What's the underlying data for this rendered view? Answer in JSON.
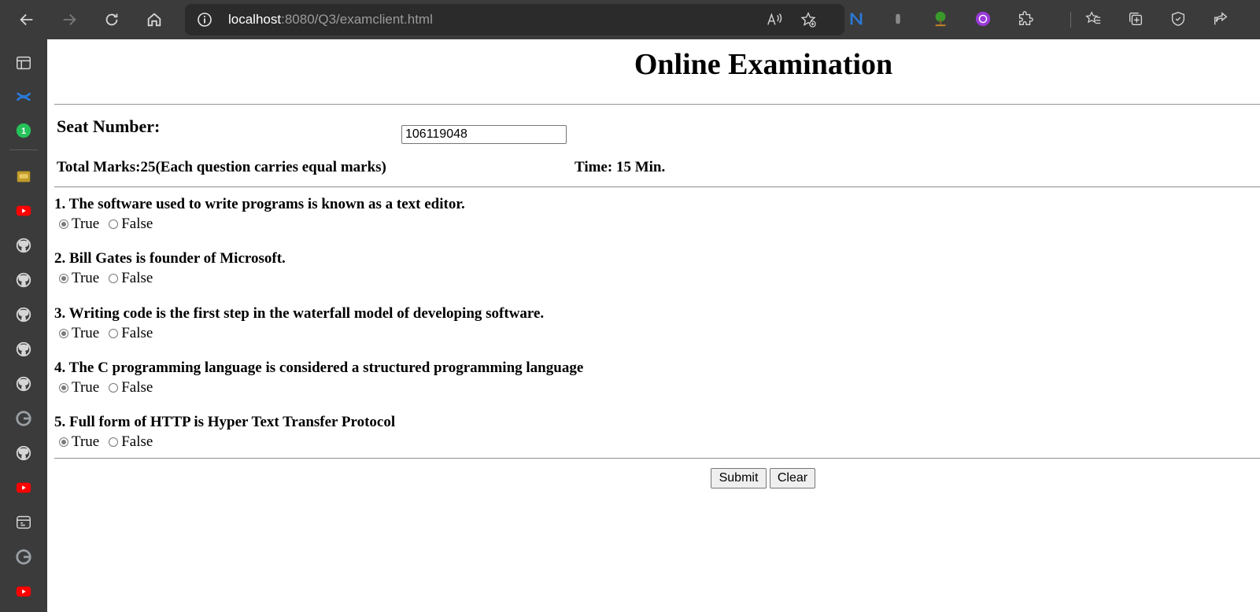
{
  "browser": {
    "url_host": "localhost",
    "url_path": ":8080/Q3/examclient.html"
  },
  "page": {
    "title": "Online Examination",
    "seat_label": "Seat Number:",
    "seat_value": "106119048",
    "total_marks": "Total Marks:25(Each question carries equal marks)",
    "time": "Time: 15 Min.",
    "questions": [
      {
        "text": "1. The software used to write programs is known as a text editor.",
        "selected": "True"
      },
      {
        "text": "2. Bill Gates is founder of Microsoft.",
        "selected": "True"
      },
      {
        "text": "3. Writing code is the first step in the waterfall model of developing software.",
        "selected": "True"
      },
      {
        "text": "4. The C programming language is considered a structured programming language",
        "selected": "True"
      },
      {
        "text": "5. Full form of HTTP is Hyper Text Transfer Protocol",
        "selected": "True"
      }
    ],
    "option_true": "True",
    "option_false": "False",
    "submit_label": "Submit",
    "clear_label": "Clear"
  },
  "colors": {
    "chrome": "#3b3b3b",
    "addressbar": "#2b2b2b",
    "page_bg": "#ffffff"
  },
  "sidebar_icons": [
    "panel-icon",
    "confluence-icon",
    "whatsapp-icon",
    "folder-icon",
    "youtube-icon",
    "github-icon",
    "github-icon",
    "github-icon",
    "github-icon",
    "github-icon",
    "google-icon",
    "github-icon",
    "youtube-icon",
    "app-icon",
    "google-icon",
    "youtube-icon"
  ],
  "sidebar_badge": "1"
}
